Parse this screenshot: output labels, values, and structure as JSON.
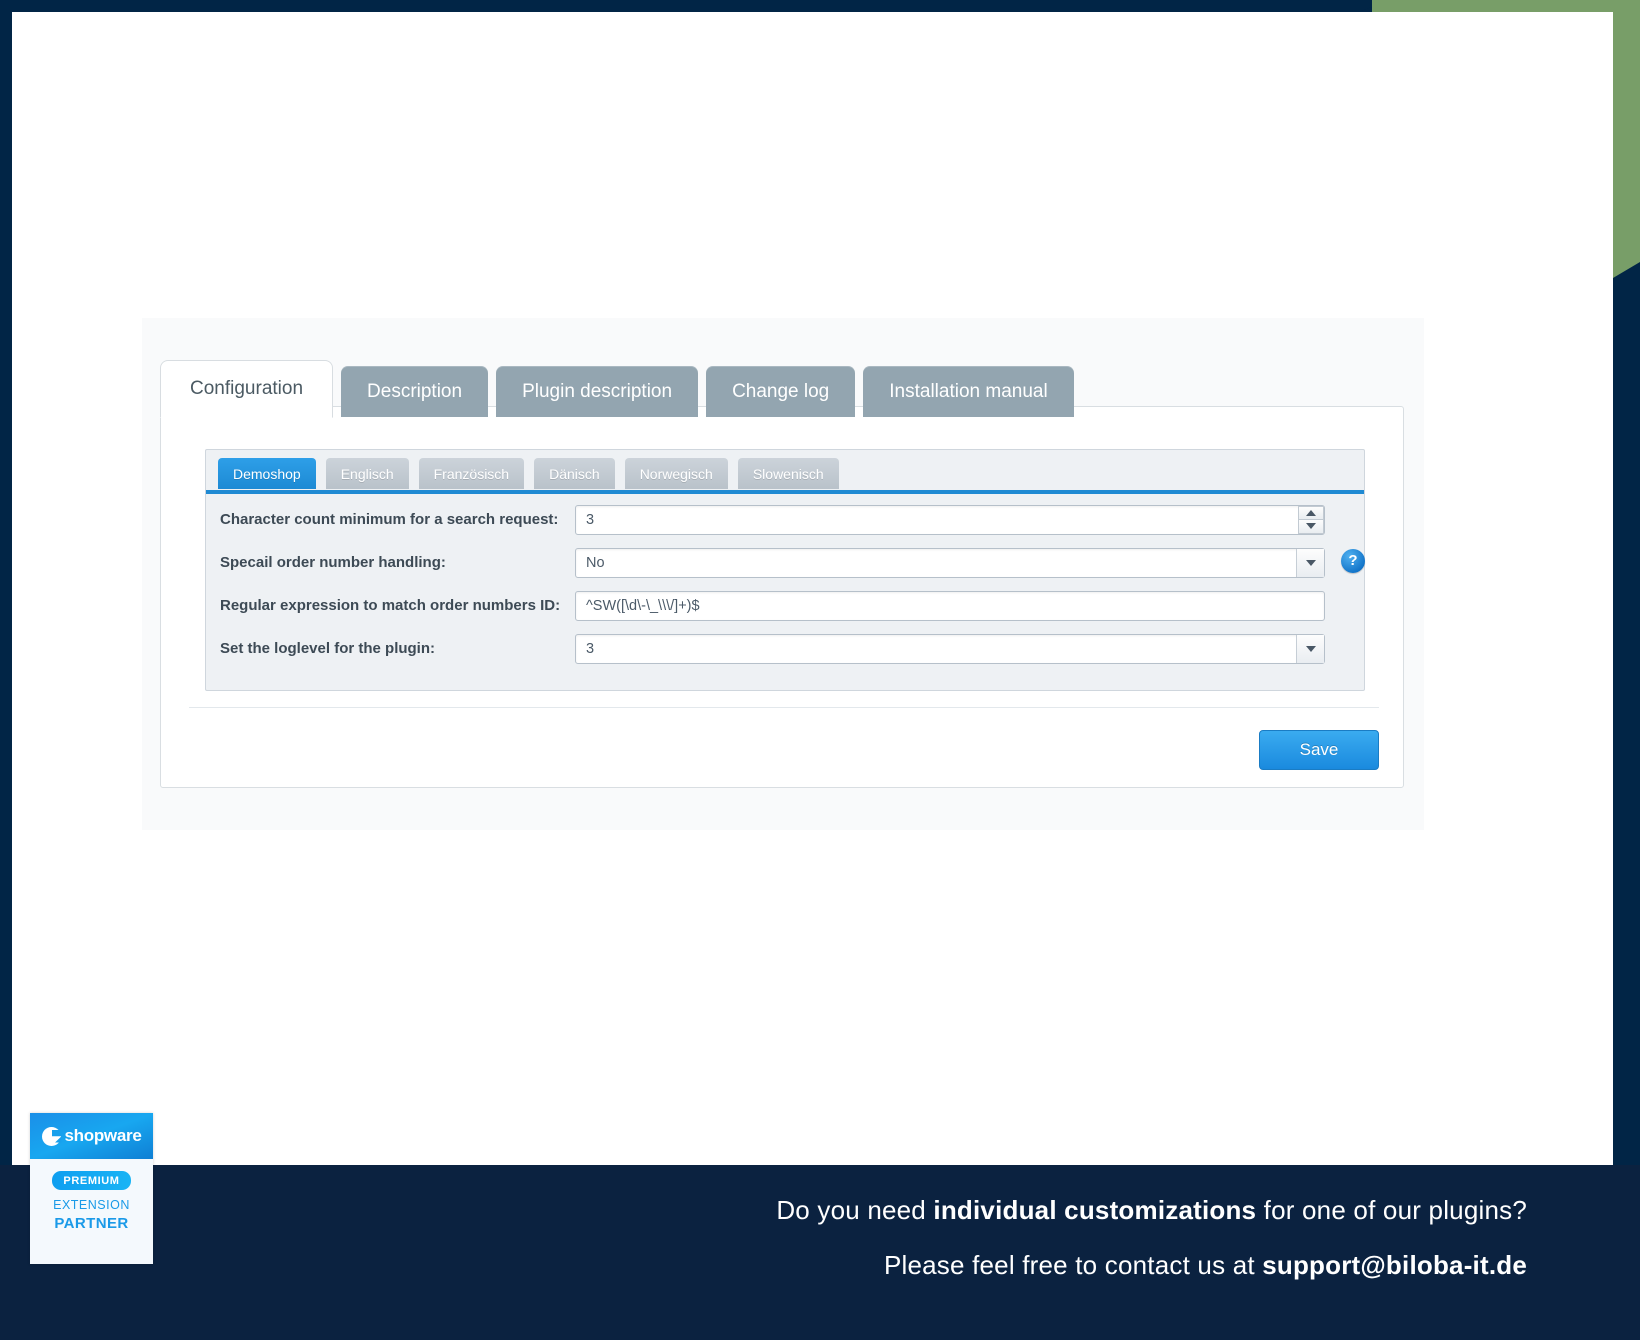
{
  "frame": {
    "navy_color": "#012546",
    "green_color": "#789e68"
  },
  "banner": {
    "background": "#0b2240",
    "line1_prefix": "Do you need ",
    "line1_bold": "individual customizations",
    "line1_suffix": " for one of our plugins?",
    "line2_prefix": "Please feel free to contact us at ",
    "line2_bold": "support@biloba-it.de"
  },
  "badge": {
    "brand": "shopware",
    "brand_icon": "shopware-logo-icon",
    "pill": "PREMIUM",
    "line1": "EXTENSION",
    "line2": "PARTNER",
    "accent": "#1a9ae8"
  },
  "screenshot": {
    "tabs": [
      {
        "label": "Configuration",
        "active": true
      },
      {
        "label": "Description",
        "active": false
      },
      {
        "label": "Plugin description",
        "active": false
      },
      {
        "label": "Change log",
        "active": false
      },
      {
        "label": "Installation manual",
        "active": false
      }
    ],
    "language_tabs": [
      {
        "label": "Demoshop",
        "active": true
      },
      {
        "label": "Englisch",
        "active": false
      },
      {
        "label": "Französisch",
        "active": false
      },
      {
        "label": "Dänisch",
        "active": false
      },
      {
        "label": "Norwegisch",
        "active": false
      },
      {
        "label": "Slowenisch",
        "active": false
      }
    ],
    "fields": [
      {
        "label": "Character count minimum for a search request:",
        "value": "3",
        "control": "number-spinner",
        "help": false
      },
      {
        "label": "Specail order number handling:",
        "value": "No",
        "control": "select",
        "help": true,
        "help_icon": "question-mark-icon"
      },
      {
        "label": "Regular expression to match order numbers ID:",
        "value": "^SW([\\d\\-\\_\\\\\\/]+)$",
        "control": "text",
        "help": false
      },
      {
        "label": "Set the loglevel for the plugin:",
        "value": "3",
        "control": "select",
        "help": false
      }
    ],
    "save_label": "Save",
    "accent": "#1f8ad3"
  }
}
